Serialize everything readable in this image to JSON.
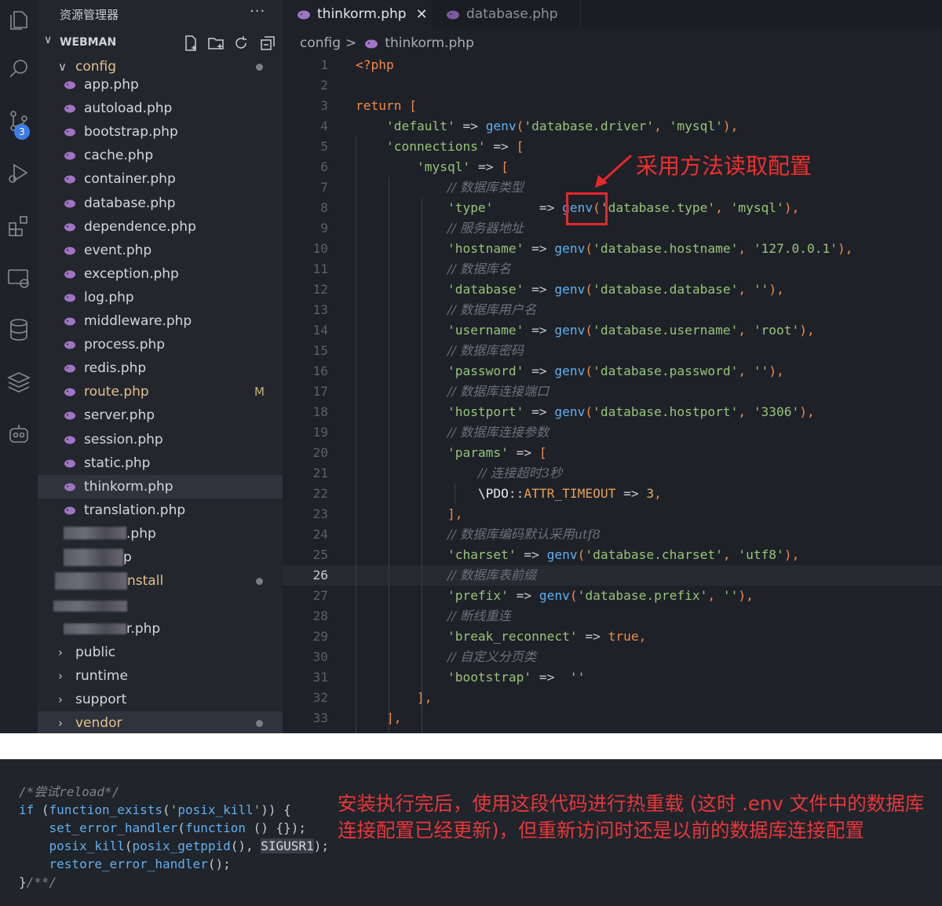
{
  "sidebar": {
    "title": "资源管理器",
    "more": "···",
    "workspace": "WEBMAN",
    "folder_config": "config",
    "files": [
      {
        "label": "app.php"
      },
      {
        "label": "autoload.php"
      },
      {
        "label": "bootstrap.php"
      },
      {
        "label": "cache.php"
      },
      {
        "label": "container.php"
      },
      {
        "label": "database.php"
      },
      {
        "label": "dependence.php"
      },
      {
        "label": "event.php"
      },
      {
        "label": "exception.php"
      },
      {
        "label": "log.php"
      },
      {
        "label": "middleware.php"
      },
      {
        "label": "process.php"
      },
      {
        "label": "redis.php"
      },
      {
        "label": "route.php",
        "status": "M"
      },
      {
        "label": "server.php"
      },
      {
        "label": "session.php"
      },
      {
        "label": "static.php"
      },
      {
        "label": "thinkorm.php"
      },
      {
        "label": "translation.php"
      }
    ],
    "obscured": [
      ".php",
      "p",
      "nstall",
      "",
      "r.php"
    ],
    "folders": [
      "public",
      "runtime",
      "support",
      "vendor"
    ]
  },
  "tabs": [
    {
      "label": "thinkorm.php",
      "close": "✕"
    },
    {
      "label": "database.php"
    }
  ],
  "breadcrumb": {
    "folder": "config",
    "sep": ">",
    "file": "thinkorm.php"
  },
  "badge_count": "3",
  "code_lines": [
    "<?php",
    "",
    "return [",
    "    'default' => genv('database.driver', 'mysql'),",
    "    'connections' => [",
    "        'mysql' => [",
    "            // 数据库类型",
    "            'type'      => genv('database.type', 'mysql'),",
    "            // 服务器地址",
    "            'hostname' => genv('database.hostname', '127.0.0.1'),",
    "            // 数据库名",
    "            'database' => genv('database.database', ''),",
    "            // 数据库用户名",
    "            'username' => genv('database.username', 'root'),",
    "            // 数据库密码",
    "            'password' => genv('database.password', ''),",
    "            // 数据库连接端口",
    "            'hostport' => genv('database.hostport', '3306'),",
    "            // 数据库连接参数",
    "            'params' => [",
    "                // 连接超时3秒",
    "                \\PDO::ATTR_TIMEOUT => 3,",
    "            ],",
    "            // 数据库编码默认采用utf8",
    "            'charset' => genv('database.charset', 'utf8'),",
    "            // 数据库表前缀",
    "            'prefix' => genv('database.prefix', ''),",
    "            // 断线重连",
    "            'break_reconnect' => true,",
    "            // 自定义分页类",
    "            'bootstrap' =>  ''",
    "        ],",
    "    ],"
  ],
  "current_line": 26,
  "annotation": {
    "label": "采用方法读取配置",
    "color": "#e8262b"
  },
  "snippet": {
    "lines": [
      "/*尝试reload*/",
      "if (function_exists('posix_kill')) {",
      "    set_error_handler(function () {});",
      "    posix_kill(posix_getppid(), SIGUSR1);",
      "    restore_error_handler();",
      "}/**/"
    ],
    "note": "安装执行完后，使用这段代码进行热重载 (这时 .env 文件中的数据库连接配置已经更新)，但重新访问时还是以前的数据库连接配置"
  },
  "icons": {
    "activity": [
      "explorer-icon",
      "search-icon",
      "source-control-icon",
      "run-debug-icon",
      "extensions-icon",
      "remote-explorer-icon",
      "database-icon",
      "layers-icon",
      "robot-icon"
    ],
    "workspace_tools": [
      "new-file-icon",
      "new-folder-icon",
      "refresh-icon",
      "collapse-all-icon"
    ],
    "file": "php-elephant-icon"
  },
  "colors": {
    "accent": "#3c7de6",
    "annotation": "#e8262b",
    "note": "#e8373a"
  }
}
